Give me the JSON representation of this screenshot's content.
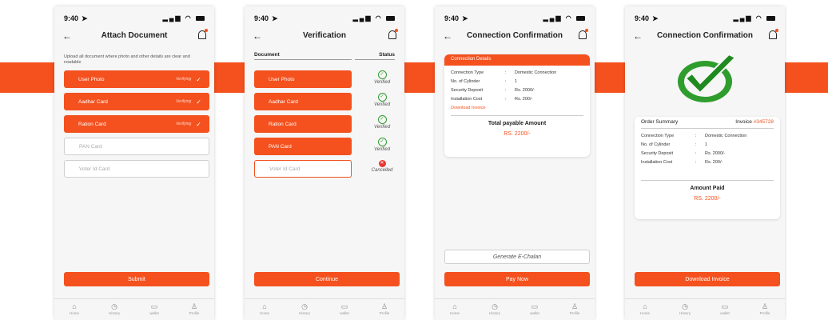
{
  "status": {
    "time": "9:40",
    "icons": "ıl ◠ "
  },
  "tabs": [
    "Home",
    "History",
    "wallet",
    "Profile"
  ],
  "screen1": {
    "title": "Attach Document",
    "intro": "Upload all document where photo and other details are clear and readable",
    "fields": [
      {
        "label": "User Photo",
        "status": "Verifying"
      },
      {
        "label": "Aadhar Card",
        "status": "Verifying"
      },
      {
        "label": "Ration Card",
        "status": "Verifying"
      },
      {
        "label": "PAN Card",
        "status": ""
      },
      {
        "label": "Voter Id Card",
        "status": ""
      }
    ],
    "submit": "Submit"
  },
  "screen2": {
    "title": "Verification",
    "col_document": "Document",
    "col_status": "Status",
    "rows": [
      {
        "label": "User Photo",
        "status": "Verified"
      },
      {
        "label": "Aadhar Card",
        "status": "Verified"
      },
      {
        "label": "Ration Card",
        "status": "Verified"
      },
      {
        "label": "PAN Card",
        "status": "Verified"
      },
      {
        "label": "Voter Id Card",
        "status": "Cancelled"
      }
    ],
    "continue": "Continue"
  },
  "screen3": {
    "title": "Connection Confirmation",
    "card_title": "Connection Details",
    "details": [
      {
        "k": "Connection Type",
        "v": "Domestic Connection"
      },
      {
        "k": "No. of Cylinder",
        "v": "1"
      },
      {
        "k": "Security Deposit",
        "v": "Rs. 2000/-"
      },
      {
        "k": "Installation Cost",
        "v": "Rs. 200/-"
      }
    ],
    "download_link": "Download Invoice",
    "total_label": "Total payable Amount",
    "total_amount": "RS. 2200/-",
    "generate": "Generate E-Chalan",
    "pay": "Pay Now"
  },
  "screen4": {
    "title": "Connection Confirmation",
    "summary_label": "Order Summary",
    "invoice_label": "Invoice",
    "invoice_no": "#345728",
    "details": [
      {
        "k": "Connection Type",
        "v": "Domestic Connection"
      },
      {
        "k": "No. of Cylinder",
        "v": "1"
      },
      {
        "k": "Security Deposit",
        "v": "Rs. 2000/-"
      },
      {
        "k": "Installation Cost",
        "v": "Rs. 200/-"
      }
    ],
    "paid_label": "Amount Paid",
    "paid_amount": "RS. 2200/-",
    "download": "Download Invoice"
  },
  "colors": {
    "accent": "#f4511e",
    "success": "#2e9d2e",
    "error": "#e53935"
  }
}
